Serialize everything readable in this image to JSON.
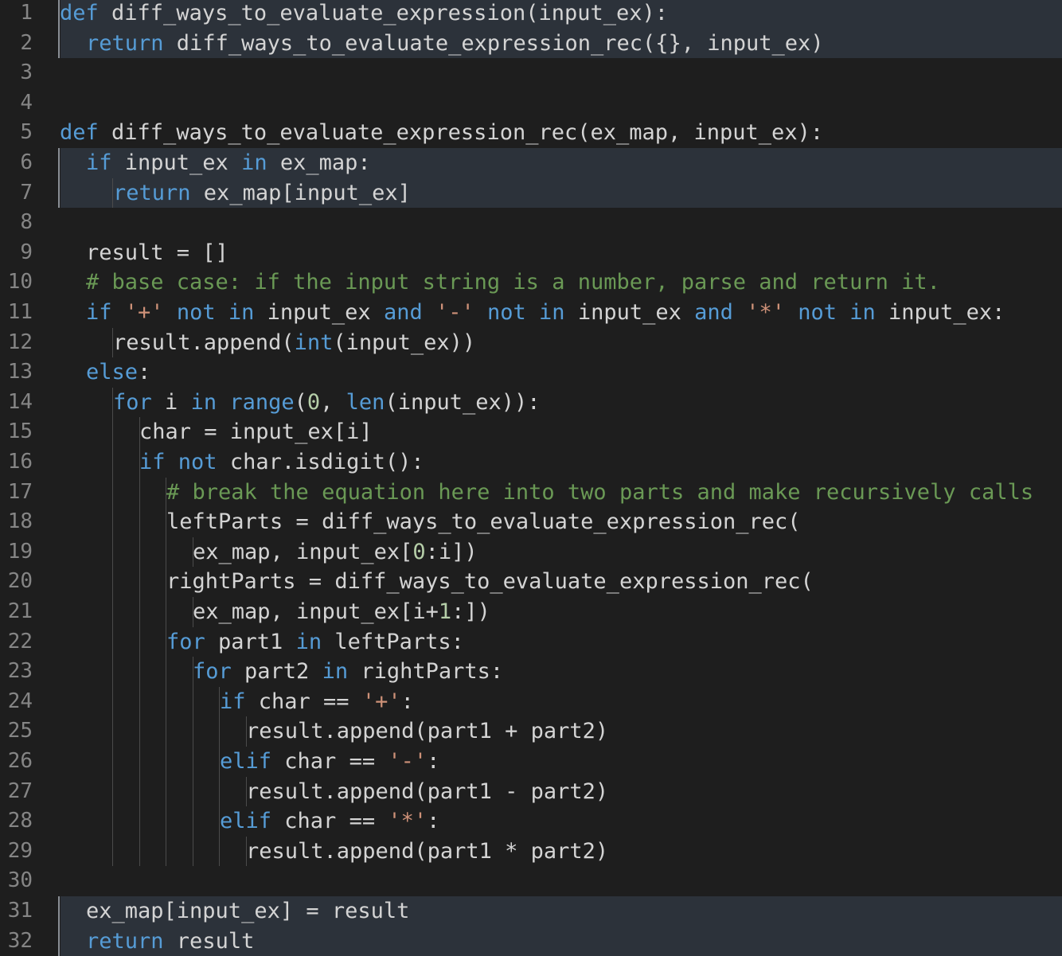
{
  "theme": {
    "background": "#1e1e1e",
    "highlight": "#2c323a",
    "text": "#d4d4d4",
    "keyword": "#569cd6",
    "string": "#ce9178",
    "comment": "#6a9955",
    "number": "#b5cea8",
    "line_number": "#858585"
  },
  "editor": {
    "lines": [
      {
        "number": "1",
        "indent": 0,
        "tokens": [
          {
            "t": "def",
            "c": "k"
          },
          {
            "t": " diff_ways_to_evaluate_expression(input_ex):"
          }
        ]
      },
      {
        "number": "2",
        "indent": 1,
        "tokens": [
          {
            "t": "return",
            "c": "k"
          },
          {
            "t": " diff_ways_to_evaluate_expression_rec({}, input_ex)"
          }
        ]
      },
      {
        "number": "3",
        "indent": 0,
        "tokens": []
      },
      {
        "number": "4",
        "indent": 0,
        "tokens": []
      },
      {
        "number": "5",
        "indent": 0,
        "tokens": [
          {
            "t": "def",
            "c": "k"
          },
          {
            "t": " diff_ways_to_evaluate_expression_rec(ex_map, input_ex):"
          }
        ]
      },
      {
        "number": "6",
        "indent": 1,
        "tokens": [
          {
            "t": "if",
            "c": "k"
          },
          {
            "t": " input_ex "
          },
          {
            "t": "in",
            "c": "k"
          },
          {
            "t": " ex_map:"
          }
        ]
      },
      {
        "number": "7",
        "indent": 2,
        "tokens": [
          {
            "t": "return",
            "c": "k"
          },
          {
            "t": " ex_map[input_ex]"
          }
        ]
      },
      {
        "number": "8",
        "indent": 0,
        "tokens": []
      },
      {
        "number": "9",
        "indent": 1,
        "tokens": [
          {
            "t": "result = []"
          }
        ]
      },
      {
        "number": "10",
        "indent": 1,
        "tokens": [
          {
            "t": "# base case: if the input string is a number, parse and return it.",
            "c": "c"
          }
        ]
      },
      {
        "number": "11",
        "indent": 1,
        "tokens": [
          {
            "t": "if",
            "c": "k"
          },
          {
            "t": " "
          },
          {
            "t": "'+'",
            "c": "s"
          },
          {
            "t": " "
          },
          {
            "t": "not in",
            "c": "k"
          },
          {
            "t": " input_ex "
          },
          {
            "t": "and",
            "c": "k"
          },
          {
            "t": " "
          },
          {
            "t": "'-'",
            "c": "s"
          },
          {
            "t": " "
          },
          {
            "t": "not in",
            "c": "k"
          },
          {
            "t": " input_ex "
          },
          {
            "t": "and",
            "c": "k"
          },
          {
            "t": " "
          },
          {
            "t": "'*'",
            "c": "s"
          },
          {
            "t": " "
          },
          {
            "t": "not in",
            "c": "k"
          },
          {
            "t": " input_ex:"
          }
        ]
      },
      {
        "number": "12",
        "indent": 2,
        "tokens": [
          {
            "t": "result.append("
          },
          {
            "t": "int",
            "c": "k"
          },
          {
            "t": "(input_ex))"
          }
        ]
      },
      {
        "number": "13",
        "indent": 1,
        "tokens": [
          {
            "t": "else",
            "c": "k"
          },
          {
            "t": ":"
          }
        ]
      },
      {
        "number": "14",
        "indent": 2,
        "tokens": [
          {
            "t": "for",
            "c": "k"
          },
          {
            "t": " i "
          },
          {
            "t": "in",
            "c": "k"
          },
          {
            "t": " "
          },
          {
            "t": "range",
            "c": "k"
          },
          {
            "t": "("
          },
          {
            "t": "0",
            "c": "n"
          },
          {
            "t": ", "
          },
          {
            "t": "len",
            "c": "k"
          },
          {
            "t": "(input_ex)):"
          }
        ]
      },
      {
        "number": "15",
        "indent": 3,
        "tokens": [
          {
            "t": "char = input_ex[i]"
          }
        ]
      },
      {
        "number": "16",
        "indent": 3,
        "tokens": [
          {
            "t": "if",
            "c": "k"
          },
          {
            "t": " "
          },
          {
            "t": "not",
            "c": "k"
          },
          {
            "t": " char.isdigit():"
          }
        ]
      },
      {
        "number": "17",
        "indent": 4,
        "tokens": [
          {
            "t": "# break the equation here into two parts and make recursively calls",
            "c": "c"
          }
        ]
      },
      {
        "number": "18",
        "indent": 4,
        "tokens": [
          {
            "t": "leftParts = diff_ways_to_evaluate_expression_rec("
          }
        ]
      },
      {
        "number": "19",
        "indent": 5,
        "tokens": [
          {
            "t": "ex_map, input_ex["
          },
          {
            "t": "0",
            "c": "n"
          },
          {
            "t": ":i])"
          }
        ]
      },
      {
        "number": "20",
        "indent": 4,
        "tokens": [
          {
            "t": "rightParts = diff_ways_to_evaluate_expression_rec("
          }
        ]
      },
      {
        "number": "21",
        "indent": 5,
        "tokens": [
          {
            "t": "ex_map, input_ex[i+"
          },
          {
            "t": "1",
            "c": "n"
          },
          {
            "t": ":])"
          }
        ]
      },
      {
        "number": "22",
        "indent": 4,
        "tokens": [
          {
            "t": "for",
            "c": "k"
          },
          {
            "t": " part1 "
          },
          {
            "t": "in",
            "c": "k"
          },
          {
            "t": " leftParts:"
          }
        ]
      },
      {
        "number": "23",
        "indent": 5,
        "tokens": [
          {
            "t": "for",
            "c": "k"
          },
          {
            "t": " part2 "
          },
          {
            "t": "in",
            "c": "k"
          },
          {
            "t": " rightParts:"
          }
        ]
      },
      {
        "number": "24",
        "indent": 6,
        "tokens": [
          {
            "t": "if",
            "c": "k"
          },
          {
            "t": " char == "
          },
          {
            "t": "'+'",
            "c": "s"
          },
          {
            "t": ":"
          }
        ]
      },
      {
        "number": "25",
        "indent": 7,
        "tokens": [
          {
            "t": "result.append(part1 + part2)"
          }
        ]
      },
      {
        "number": "26",
        "indent": 6,
        "tokens": [
          {
            "t": "elif",
            "c": "k"
          },
          {
            "t": " char == "
          },
          {
            "t": "'-'",
            "c": "s"
          },
          {
            "t": ":"
          }
        ]
      },
      {
        "number": "27",
        "indent": 7,
        "tokens": [
          {
            "t": "result.append(part1 - part2)"
          }
        ]
      },
      {
        "number": "28",
        "indent": 6,
        "tokens": [
          {
            "t": "elif",
            "c": "k"
          },
          {
            "t": " char == "
          },
          {
            "t": "'*'",
            "c": "s"
          },
          {
            "t": ":"
          }
        ]
      },
      {
        "number": "29",
        "indent": 7,
        "tokens": [
          {
            "t": "result.append(part1 * part2)"
          }
        ]
      },
      {
        "number": "30",
        "indent": 0,
        "tokens": []
      },
      {
        "number": "31",
        "indent": 1,
        "tokens": [
          {
            "t": "ex_map[input_ex] = result"
          }
        ]
      },
      {
        "number": "32",
        "indent": 1,
        "tokens": [
          {
            "t": "return",
            "c": "k"
          },
          {
            "t": " result"
          }
        ]
      }
    ]
  }
}
